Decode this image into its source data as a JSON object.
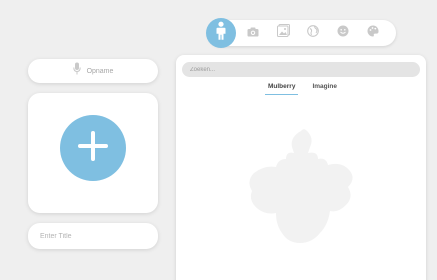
{
  "toolbar": {
    "tools": [
      {
        "icon": "person-icon",
        "active": true
      },
      {
        "icon": "camera-icon",
        "active": false
      },
      {
        "icon": "image-icon",
        "active": false
      },
      {
        "icon": "globe-icon",
        "active": false
      },
      {
        "icon": "emoji-icon",
        "active": false
      },
      {
        "icon": "palette-icon",
        "active": false
      }
    ]
  },
  "record": {
    "label": "Opname",
    "icon": "microphone-icon"
  },
  "add": {
    "icon": "plus-icon"
  },
  "title_field": {
    "placeholder": "Enter Title",
    "value": ""
  },
  "library": {
    "search_placeholder": "Zoeken...",
    "tabs": [
      {
        "label": "Mulberry",
        "active": true
      },
      {
        "label": "Imagine",
        "active": false
      }
    ]
  },
  "colors": {
    "accent": "#7fbfe1",
    "background": "#efefef",
    "card": "#ffffff",
    "watermark": "#f2f2f2"
  }
}
